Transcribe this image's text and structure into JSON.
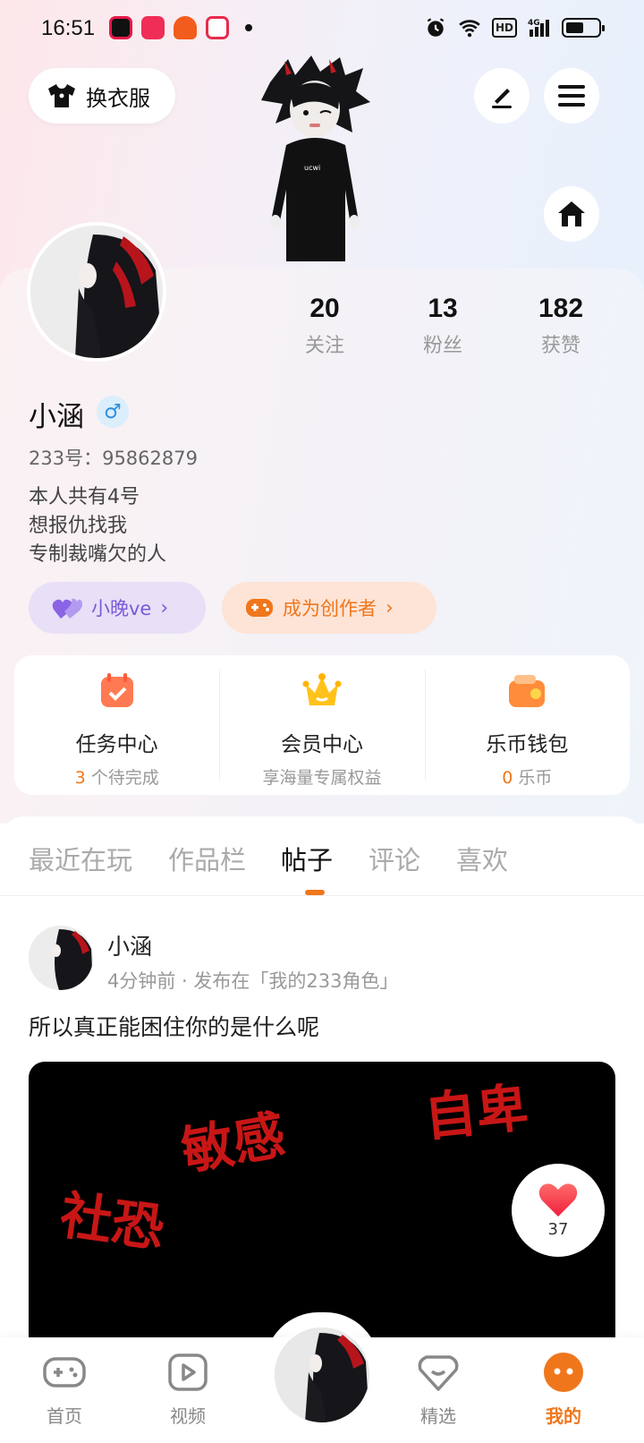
{
  "status_bar": {
    "time": "16:51",
    "network": "4G",
    "hd": "HD",
    "battery_level": 0.55
  },
  "top": {
    "outfit_label": "换衣服"
  },
  "profile": {
    "name": "小涵",
    "gender_symbol": "♂",
    "uid": "233号：95862879",
    "bio": [
      "本人共有4号",
      "想报仇找我",
      "专制裁嘴欠的人"
    ],
    "stats": [
      {
        "num": "20",
        "label": "关注"
      },
      {
        "num": "13",
        "label": "粉丝"
      },
      {
        "num": "182",
        "label": "获赞"
      }
    ],
    "fan_pill": "小晚ve",
    "creator_pill": "成为创作者"
  },
  "quick": [
    {
      "title": "任务中心",
      "sub_highlight": "3",
      "sub_text": " 个待完成"
    },
    {
      "title": "会员中心",
      "sub_highlight": "",
      "sub_text": "享海量专属权益"
    },
    {
      "title": "乐币钱包",
      "sub_highlight": "0",
      "sub_text": " 乐币"
    }
  ],
  "tabs": [
    "最近在玩",
    "作品栏",
    "帖子",
    "评论",
    "喜欢"
  ],
  "post": {
    "author": "小涵",
    "meta": "4分钟前 · 发布在「我的233角色」",
    "text": "所以真正能困住你的是什么呢",
    "image_words": [
      "敏感",
      "自卑",
      "社恐"
    ],
    "likes": "37"
  },
  "nav": [
    {
      "label": "首页"
    },
    {
      "label": "视频"
    },
    {
      "label": "精选"
    },
    {
      "label": "我的"
    }
  ],
  "colors": {
    "accent": "#f0761c",
    "fan_purple": "#7a5ad6",
    "image_text_red": "#c81616"
  }
}
